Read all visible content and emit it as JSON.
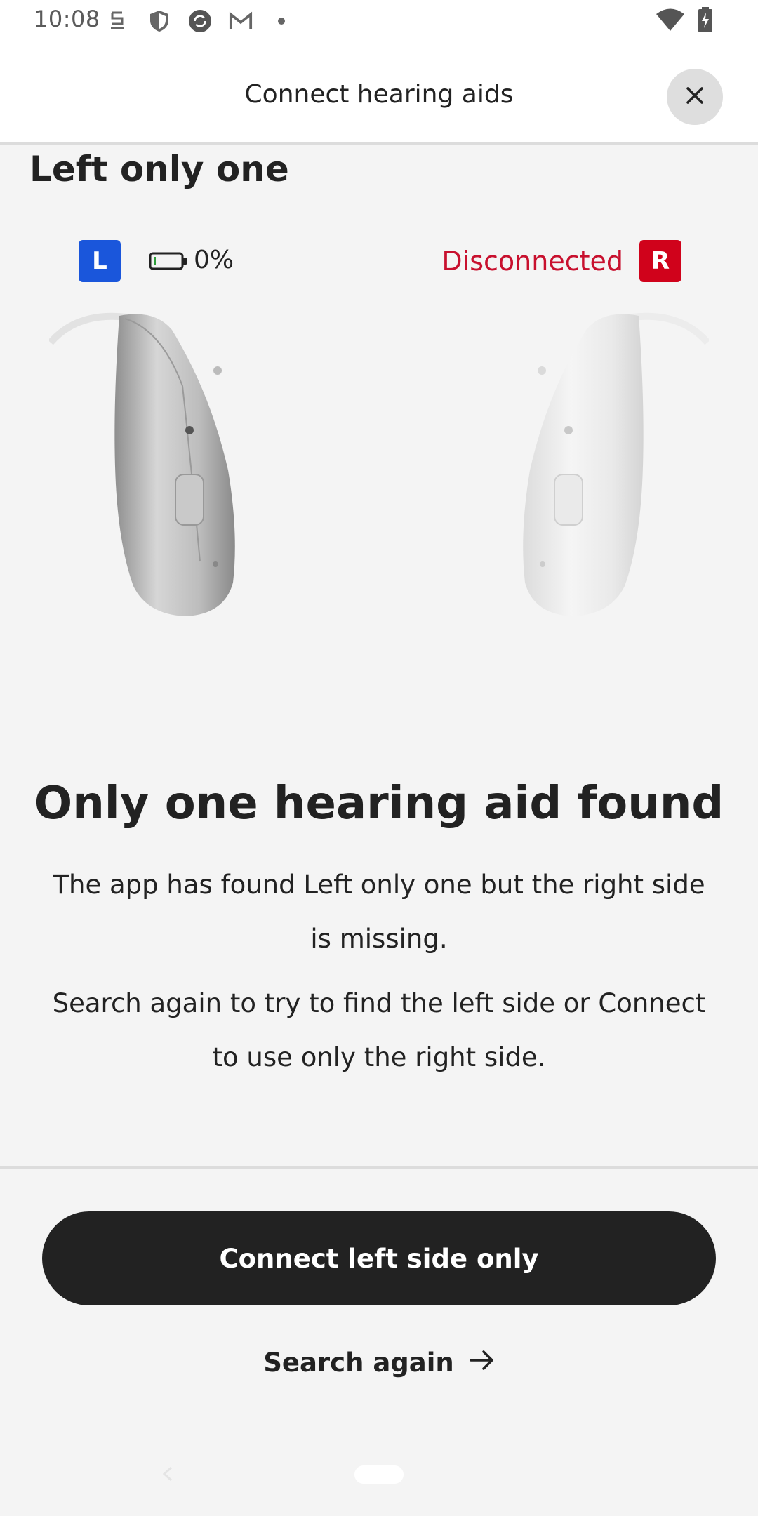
{
  "status_bar": {
    "time": "10:08",
    "icons": [
      "face-id-icon",
      "shield-icon",
      "sync-icon",
      "gmail-icon",
      "dot-icon"
    ],
    "right_icons": [
      "wifi-icon",
      "battery-charging-icon"
    ]
  },
  "header": {
    "title": "Connect hearing aids",
    "close_icon": "close-icon"
  },
  "device": {
    "name": "Left only one",
    "left": {
      "badge": "L",
      "battery_text": "0%",
      "color": "#1a56db",
      "battery_level": 0.0
    },
    "right": {
      "badge": "R",
      "status": "Disconnected",
      "color": "#d0021b"
    }
  },
  "main": {
    "heading": "Only one hearing aid found",
    "paragraph1": "The app has found Left only one but the right side is missing.",
    "paragraph2": "Search again to try to find the left side or Connect to use only the right side."
  },
  "actions": {
    "connect_label": "Connect left side only",
    "search_again_label": "Search again"
  },
  "colors": {
    "accent_blue": "#1a56db",
    "alert_red": "#d0021b",
    "button_dark": "#222222"
  }
}
